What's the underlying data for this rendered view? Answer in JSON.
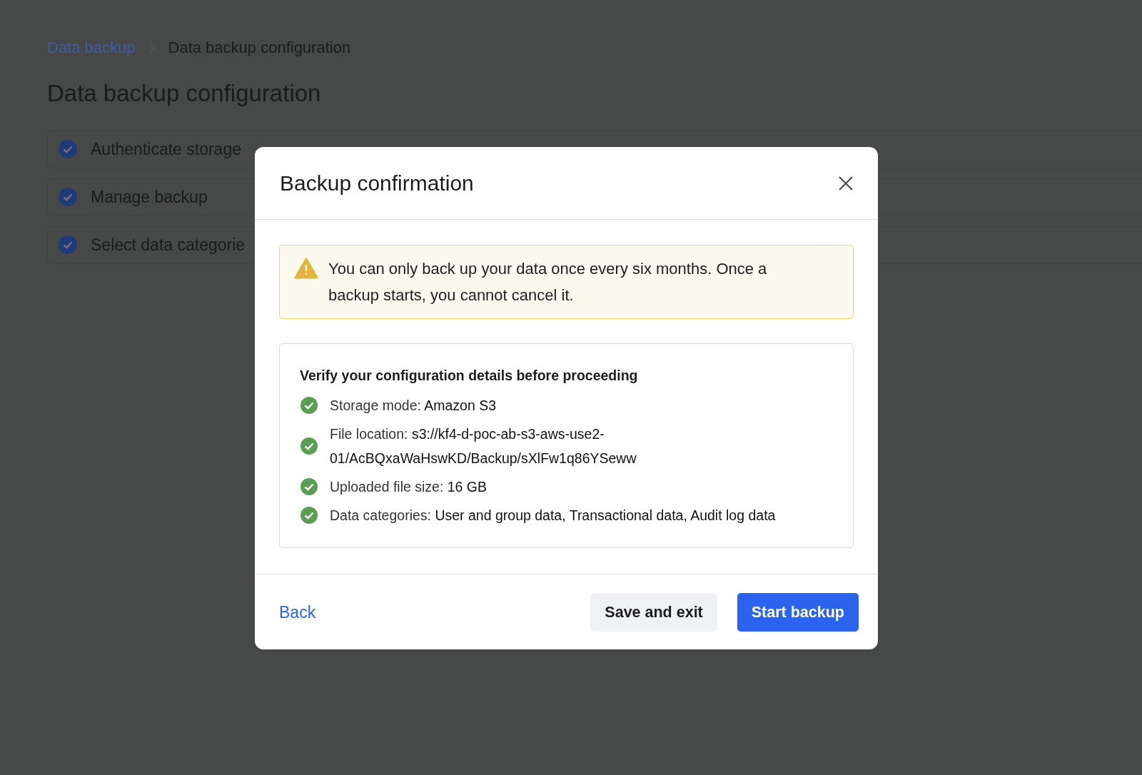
{
  "breadcrumb": [
    {
      "label": "Data backup",
      "kind": "link"
    },
    {
      "label": "Data backup configuration",
      "kind": "current"
    }
  ],
  "page_title": "Data backup configuration",
  "steps": [
    {
      "label": "Authenticate storage",
      "completed": true
    },
    {
      "label": "Manage backup",
      "completed": true
    },
    {
      "label": "Select data categorie",
      "completed": true
    }
  ],
  "modal": {
    "title": "Backup confirmation",
    "warning": "You can only back up your data once every six months. Once a backup starts, you cannot cancel it.",
    "details_heading": "Verify your configuration details before proceeding",
    "details": [
      {
        "label": "Storage mode:",
        "value": "Amazon S3",
        "verified": true
      },
      {
        "label": "File location:",
        "value": "s3://kf4-d-poc-ab-s3-aws-use2-01/AcBQxaWaHswKD/Backup/sXlFw1q86YSeww",
        "verified": true
      },
      {
        "label": "Uploaded file size:",
        "value": "16 GB",
        "verified": true
      },
      {
        "label": "Data categories:",
        "value": "User and group data, Transactional data, Audit log data",
        "verified": true
      }
    ],
    "buttons": [
      {
        "label": "Back",
        "kind": "link"
      },
      {
        "label": "Save and exit",
        "kind": "secondary"
      },
      {
        "label": "Start backup",
        "kind": "primary"
      }
    ]
  }
}
